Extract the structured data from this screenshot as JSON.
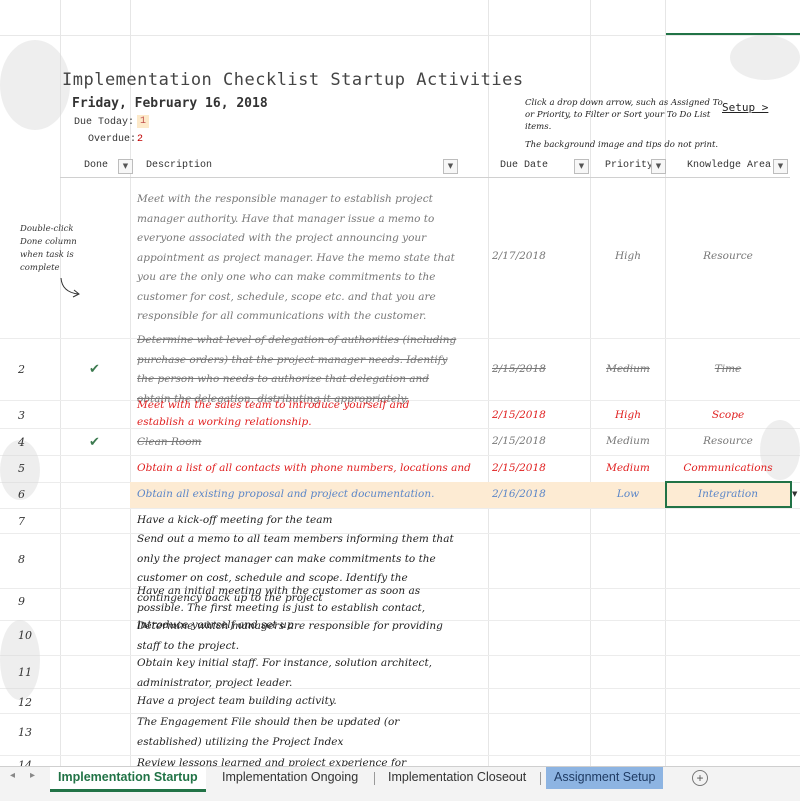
{
  "sheet": {
    "title": "Implementation Checklist Startup Activities",
    "date": "Friday, February 16, 2018",
    "due_today_label": "Due Today:",
    "due_today_value": "1",
    "overdue_label": "Overdue:",
    "overdue_value": "2",
    "tip_text": "Click a drop down arrow, such as Assigned To or Priority, to Filter or Sort your To Do List items.",
    "print_tip": "The background image and tips do not print.",
    "setup_link": "Setup >",
    "callout": "Double-click Done column when task is complete"
  },
  "headers": {
    "done": "Done",
    "description": "Description",
    "due_date": "Due Date",
    "priority": "Priority",
    "knowledge_area": "Knowledge Area"
  },
  "rows": [
    {
      "num": "",
      "done": "",
      "desc": "Meet with the responsible manager to establish project manager authority. Have that manager issue a memo to everyone associated with the project announcing your appointment as project manager. Have the memo state that you are the only one who can make commitments to the customer for cost, schedule, scope etc. and that you are responsible for all communications with the customer.",
      "due": "2/17/2018",
      "priority": "High",
      "area": "Resource"
    },
    {
      "num": "2",
      "done": "✔",
      "desc": "Determine what level of delegation of authorities (including purchase orders) that the project manager needs. Identify the person who needs to authorize that delegation and obtain the delegation, distributing it appropriately.",
      "due": "2/15/2018",
      "priority": "Medium",
      "area": "Time"
    },
    {
      "num": "3",
      "done": "",
      "desc": "Meet with the sales team to introduce yourself and establish a working relationship.",
      "due": "2/15/2018",
      "priority": "High",
      "area": "Scope"
    },
    {
      "num": "4",
      "done": "✔",
      "desc": "Clean Room",
      "due": "2/15/2018",
      "priority": "Medium",
      "area": "Resource"
    },
    {
      "num": "5",
      "done": "",
      "desc": "Obtain a list of all contacts with phone numbers, locations and roles.",
      "due": "2/15/2018",
      "priority": "Medium",
      "area": "Communications"
    },
    {
      "num": "6",
      "done": "",
      "desc": "Obtain all existing proposal and project documentation.",
      "due": "2/16/2018",
      "priority": "Low",
      "area": "Integration"
    },
    {
      "num": "7",
      "done": "",
      "desc": "Have a kick-off meeting for the team",
      "due": "",
      "priority": "",
      "area": ""
    },
    {
      "num": "8",
      "done": "",
      "desc": "Send out a memo to all team members informing them that only the project manager can make commitments to the customer on cost, schedule and scope. Identify the contingency back up to the project",
      "due": "",
      "priority": "",
      "area": ""
    },
    {
      "num": "9",
      "done": "",
      "desc": "Have an initial meeting with the customer as soon as possible. The first meeting is just to establish contact, introduce yourself and set up",
      "due": "",
      "priority": "",
      "area": ""
    },
    {
      "num": "10",
      "done": "",
      "desc": "Determine which managers are responsible for providing staff to the project.",
      "due": "",
      "priority": "",
      "area": ""
    },
    {
      "num": "11",
      "done": "",
      "desc": "Obtain key initial staff. For instance, solution architect, administrator, project leader.",
      "due": "",
      "priority": "",
      "area": ""
    },
    {
      "num": "12",
      "done": "",
      "desc": "Have a project team building activity.",
      "due": "",
      "priority": "",
      "area": ""
    },
    {
      "num": "13",
      "done": "",
      "desc": "The Engagement File should then be updated (or established) utilizing the Project Index",
      "due": "",
      "priority": "",
      "area": ""
    },
    {
      "num": "14",
      "done": "",
      "desc": "Review lessons learned and project experience for implementation",
      "due": "",
      "priority": "",
      "area": ""
    }
  ],
  "tabs": [
    "Implementation Startup",
    "Implementation Ongoing",
    "Implementation Closeout",
    "Assignment Setup"
  ],
  "colors": {
    "accent": "#217346",
    "overdue": "#e02020",
    "highlight": "#fdebd3",
    "blue_tab": "#8db4e2"
  }
}
